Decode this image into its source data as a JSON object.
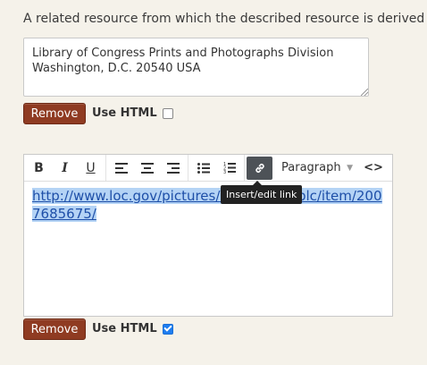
{
  "field": {
    "label": "A related resource from which the described resource is derived"
  },
  "first_entry": {
    "text": "Library of Congress Prints and Photographs Division\nWashington, D.C. 20540 USA",
    "remove_label": "Remove",
    "use_html_label": "Use HTML",
    "use_html_checked": false
  },
  "second_entry": {
    "toolbar": {
      "bold_label": "B",
      "italic_label": "I",
      "underline_label": "U",
      "format_select": "Paragraph",
      "code_label": "<>"
    },
    "link_text": "http://www.loc.gov/pictures/collection/pplc/item/2007685675/",
    "tooltip": "Insert/edit link",
    "remove_label": "Remove",
    "use_html_label": "Use HTML",
    "use_html_checked": true
  }
}
